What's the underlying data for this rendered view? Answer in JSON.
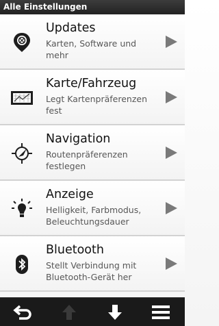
{
  "header": {
    "title": "Alle Einstellungen"
  },
  "items": [
    {
      "title": "Updates",
      "desc": "Karten, Software und mehr",
      "icon": "updates-icon"
    },
    {
      "title": "Karte/Fahrzeug",
      "desc": "Legt Kartenpräferenzen fest",
      "icon": "map-icon"
    },
    {
      "title": "Navigation",
      "desc": "Routenpräferenzen festlegen",
      "icon": "navigation-icon"
    },
    {
      "title": "Anzeige",
      "desc": "Helligkeit, Farbmodus, Beleuchtungsdauer",
      "icon": "brightness-icon"
    },
    {
      "title": "Bluetooth",
      "desc": "Stellt Verbindung mit Bluetooth-Gerät her",
      "icon": "bluetooth-icon"
    }
  ],
  "bottom_bar": {
    "buttons": [
      "back-icon",
      "scroll-up-icon",
      "scroll-down-icon",
      "menu-icon"
    ],
    "scroll_up_enabled": false
  },
  "colors": {
    "title_bar": "#2b2b2b",
    "bottom_bar": "#1a1a1a",
    "arrow": "#7a7a7a"
  }
}
